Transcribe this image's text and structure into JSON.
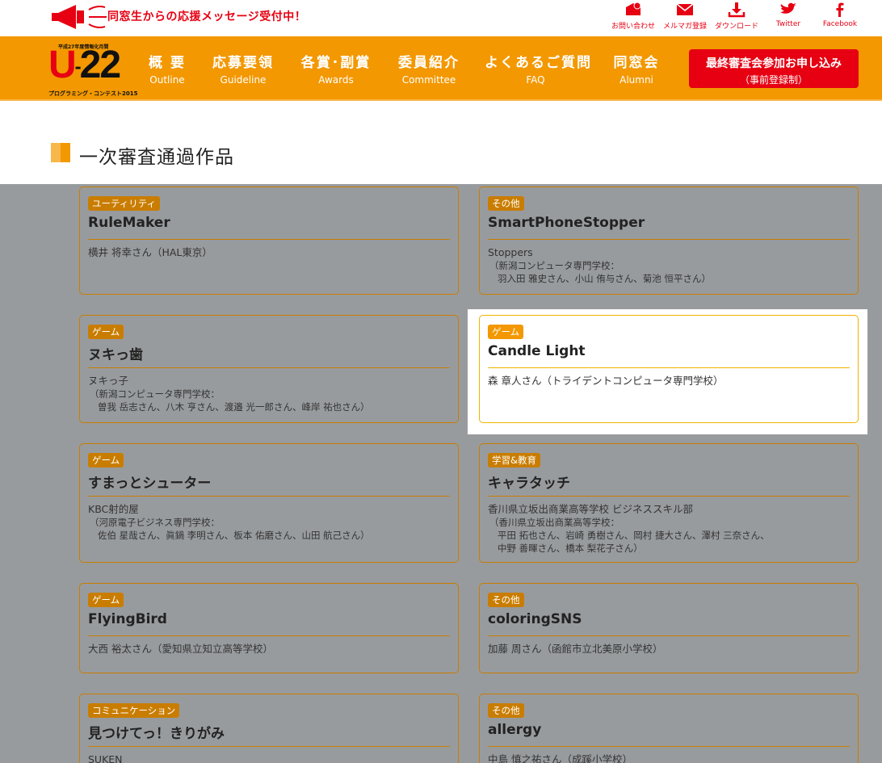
{
  "announce": "同窓生からの応援メッセージ受付中！",
  "utility_links": [
    {
      "label": "お問い合わせ",
      "icon": "mail-at-icon"
    },
    {
      "label": "メルマガ登録",
      "icon": "envelope-icon"
    },
    {
      "label": "ダウンロード",
      "icon": "download-icon"
    },
    {
      "label": "Twitter",
      "icon": "twitter-icon"
    },
    {
      "label": "Facebook",
      "icon": "facebook-icon"
    }
  ],
  "logo": {
    "small": "平成27年度情報化月間",
    "main_u": "U",
    "main_num": "22",
    "sub": "プログラミング・コンテスト2015"
  },
  "nav": [
    {
      "ja": "概 要",
      "en": "Outline"
    },
    {
      "ja": "応募要領",
      "en": "Guideline"
    },
    {
      "ja": "各賞･副賞",
      "en": "Awards"
    },
    {
      "ja": "委員紹介",
      "en": "Committee"
    },
    {
      "ja": "よくあるご質問",
      "en": "FAQ"
    },
    {
      "ja": "同窓会",
      "en": "Alumni"
    }
  ],
  "cta": {
    "line1": "最終審査会参加お申し込み",
    "line2": "（事前登録制）"
  },
  "page_title": "一次審査通過作品",
  "colors": {
    "brand_orange": "#f39800",
    "brand_red": "#e60012",
    "card_border": "#c97d00",
    "overlay": "#989b9e"
  },
  "cards": [
    {
      "category": "ユーティリティ",
      "title": "RuleMaker",
      "team": "横井 将幸さん（HAL東京）",
      "aff": "",
      "members": []
    },
    {
      "category": "その他",
      "title": "SmartPhoneStopper",
      "team": "Stoppers",
      "aff": "（新潟コンピュータ専門学校：",
      "members": [
        "羽入田 雅史さん、小山 侑与さん、菊池 恒平さん）"
      ]
    },
    {
      "category": "ゲーム",
      "title": "ヌキっ歯",
      "team": "ヌキっ子",
      "aff": "（新潟コンピュータ専門学校：",
      "members": [
        "曽我 岳志さん、八木 亨さん、渡邉 光一郎さん、峰岸 祐也さん）"
      ]
    },
    {
      "category": "ゲーム",
      "title": "Candle Light",
      "team": "森 章人さん（トライデントコンピュータ専門学校）",
      "aff": "",
      "members": []
    },
    {
      "category": "ゲーム",
      "title": "すまっとシューター",
      "team": "KBC射的屋",
      "aff": "（河原電子ビジネス専門学校：",
      "members": [
        "佐伯 星哉さん、眞鍋 李明さん、板本 佑磨さん、山田 航己さん）"
      ]
    },
    {
      "category": "学習&教育",
      "title": "キャラタッチ",
      "team": "香川県立坂出商業高等学校 ビジネススキル部",
      "aff": "（香川県立坂出商業高等学校：",
      "members": [
        "平田 拓也さん、岩崎 勇樹さん、岡村 捷大さん、澤村 三奈さん、",
        "中野 善暉さん、橋本 梨花子さん）"
      ]
    },
    {
      "category": "ゲーム",
      "title": "FlyingBird",
      "team": "大西 裕太さん（愛知県立知立高等学校）",
      "aff": "",
      "members": []
    },
    {
      "category": "その他",
      "title": "coloringSNS",
      "team": "加藤 周さん（函館市立北美原小学校）",
      "aff": "",
      "members": []
    },
    {
      "category": "コミュニケーション",
      "title": "見つけてっ！きりがみ",
      "team": "SUKEN",
      "aff": "",
      "members": []
    },
    {
      "category": "その他",
      "title": "allergy",
      "team": "中島 慎之祐さん（成蹊小学校）",
      "aff": "",
      "members": []
    }
  ]
}
